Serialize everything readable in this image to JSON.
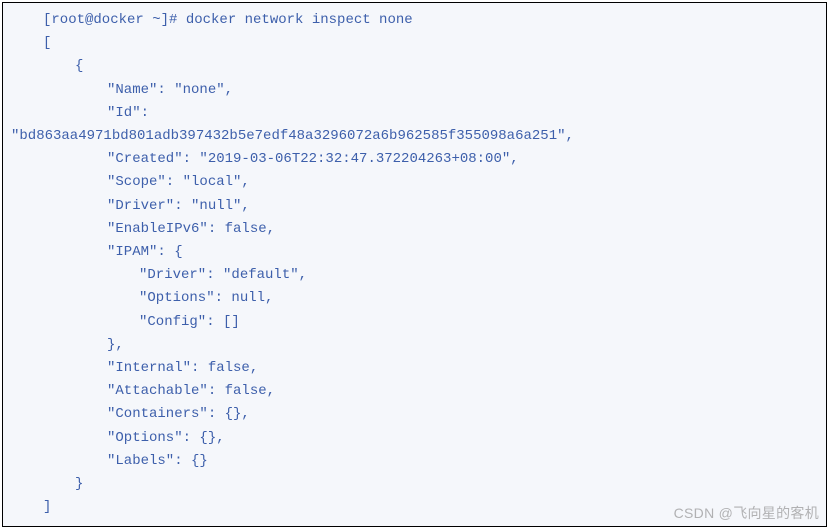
{
  "terminal": {
    "prompt": "[root@docker ~]# docker network inspect none",
    "open_bracket": "[",
    "open_brace": "{",
    "name_key": "\"Name\": \"none\",",
    "id_key": "\"Id\":",
    "id_value": "\"bd863aa4971bd801adb397432b5e7edf48a3296072a6b962585f355098a6a251\",",
    "created": "\"Created\": \"2019-03-06T22:32:47.372204263+08:00\",",
    "scope": "\"Scope\": \"local\",",
    "driver": "\"Driver\": \"null\",",
    "enableipv6": "\"EnableIPv6\": false,",
    "ipam_open": "\"IPAM\": {",
    "ipam_driver": "\"Driver\": \"default\",",
    "ipam_options": "\"Options\": null,",
    "ipam_config": "\"Config\": []",
    "ipam_close": "},",
    "internal": "\"Internal\": false,",
    "attachable": "\"Attachable\": false,",
    "containers": "\"Containers\": {},",
    "options": "\"Options\": {},",
    "labels": "\"Labels\": {}",
    "close_brace": "}",
    "close_bracket": "]"
  },
  "watermark": "CSDN @飞向星的客机"
}
